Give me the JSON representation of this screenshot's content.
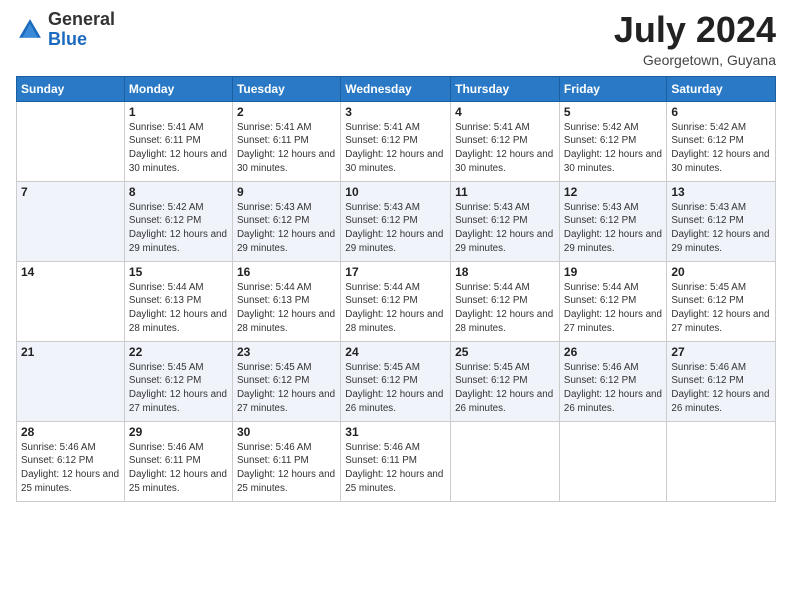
{
  "logo": {
    "general": "General",
    "blue": "Blue"
  },
  "title": "July 2024",
  "location": "Georgetown, Guyana",
  "days_of_week": [
    "Sunday",
    "Monday",
    "Tuesday",
    "Wednesday",
    "Thursday",
    "Friday",
    "Saturday"
  ],
  "weeks": [
    [
      {
        "day": "",
        "info": ""
      },
      {
        "day": "1",
        "info": "Sunrise: 5:41 AM\nSunset: 6:11 PM\nDaylight: 12 hours and 30 minutes."
      },
      {
        "day": "2",
        "info": "Sunrise: 5:41 AM\nSunset: 6:11 PM\nDaylight: 12 hours and 30 minutes."
      },
      {
        "day": "3",
        "info": "Sunrise: 5:41 AM\nSunset: 6:12 PM\nDaylight: 12 hours and 30 minutes."
      },
      {
        "day": "4",
        "info": "Sunrise: 5:41 AM\nSunset: 6:12 PM\nDaylight: 12 hours and 30 minutes."
      },
      {
        "day": "5",
        "info": "Sunrise: 5:42 AM\nSunset: 6:12 PM\nDaylight: 12 hours and 30 minutes."
      },
      {
        "day": "6",
        "info": "Sunrise: 5:42 AM\nSunset: 6:12 PM\nDaylight: 12 hours and 30 minutes."
      }
    ],
    [
      {
        "day": "7",
        "info": ""
      },
      {
        "day": "8",
        "info": "Sunrise: 5:42 AM\nSunset: 6:12 PM\nDaylight: 12 hours and 29 minutes."
      },
      {
        "day": "9",
        "info": "Sunrise: 5:43 AM\nSunset: 6:12 PM\nDaylight: 12 hours and 29 minutes."
      },
      {
        "day": "10",
        "info": "Sunrise: 5:43 AM\nSunset: 6:12 PM\nDaylight: 12 hours and 29 minutes."
      },
      {
        "day": "11",
        "info": "Sunrise: 5:43 AM\nSunset: 6:12 PM\nDaylight: 12 hours and 29 minutes."
      },
      {
        "day": "12",
        "info": "Sunrise: 5:43 AM\nSunset: 6:12 PM\nDaylight: 12 hours and 29 minutes."
      },
      {
        "day": "13",
        "info": "Sunrise: 5:43 AM\nSunset: 6:12 PM\nDaylight: 12 hours and 29 minutes."
      }
    ],
    [
      {
        "day": "14",
        "info": ""
      },
      {
        "day": "15",
        "info": "Sunrise: 5:44 AM\nSunset: 6:13 PM\nDaylight: 12 hours and 28 minutes."
      },
      {
        "day": "16",
        "info": "Sunrise: 5:44 AM\nSunset: 6:13 PM\nDaylight: 12 hours and 28 minutes."
      },
      {
        "day": "17",
        "info": "Sunrise: 5:44 AM\nSunset: 6:12 PM\nDaylight: 12 hours and 28 minutes."
      },
      {
        "day": "18",
        "info": "Sunrise: 5:44 AM\nSunset: 6:12 PM\nDaylight: 12 hours and 28 minutes."
      },
      {
        "day": "19",
        "info": "Sunrise: 5:44 AM\nSunset: 6:12 PM\nDaylight: 12 hours and 27 minutes."
      },
      {
        "day": "20",
        "info": "Sunrise: 5:45 AM\nSunset: 6:12 PM\nDaylight: 12 hours and 27 minutes."
      }
    ],
    [
      {
        "day": "21",
        "info": ""
      },
      {
        "day": "22",
        "info": "Sunrise: 5:45 AM\nSunset: 6:12 PM\nDaylight: 12 hours and 27 minutes."
      },
      {
        "day": "23",
        "info": "Sunrise: 5:45 AM\nSunset: 6:12 PM\nDaylight: 12 hours and 27 minutes."
      },
      {
        "day": "24",
        "info": "Sunrise: 5:45 AM\nSunset: 6:12 PM\nDaylight: 12 hours and 26 minutes."
      },
      {
        "day": "25",
        "info": "Sunrise: 5:45 AM\nSunset: 6:12 PM\nDaylight: 12 hours and 26 minutes."
      },
      {
        "day": "26",
        "info": "Sunrise: 5:46 AM\nSunset: 6:12 PM\nDaylight: 12 hours and 26 minutes."
      },
      {
        "day": "27",
        "info": "Sunrise: 5:46 AM\nSunset: 6:12 PM\nDaylight: 12 hours and 26 minutes."
      }
    ],
    [
      {
        "day": "28",
        "info": "Sunrise: 5:46 AM\nSunset: 6:12 PM\nDaylight: 12 hours and 25 minutes."
      },
      {
        "day": "29",
        "info": "Sunrise: 5:46 AM\nSunset: 6:11 PM\nDaylight: 12 hours and 25 minutes."
      },
      {
        "day": "30",
        "info": "Sunrise: 5:46 AM\nSunset: 6:11 PM\nDaylight: 12 hours and 25 minutes."
      },
      {
        "day": "31",
        "info": "Sunrise: 5:46 AM\nSunset: 6:11 PM\nDaylight: 12 hours and 25 minutes."
      },
      {
        "day": "",
        "info": ""
      },
      {
        "day": "",
        "info": ""
      },
      {
        "day": "",
        "info": ""
      }
    ]
  ]
}
